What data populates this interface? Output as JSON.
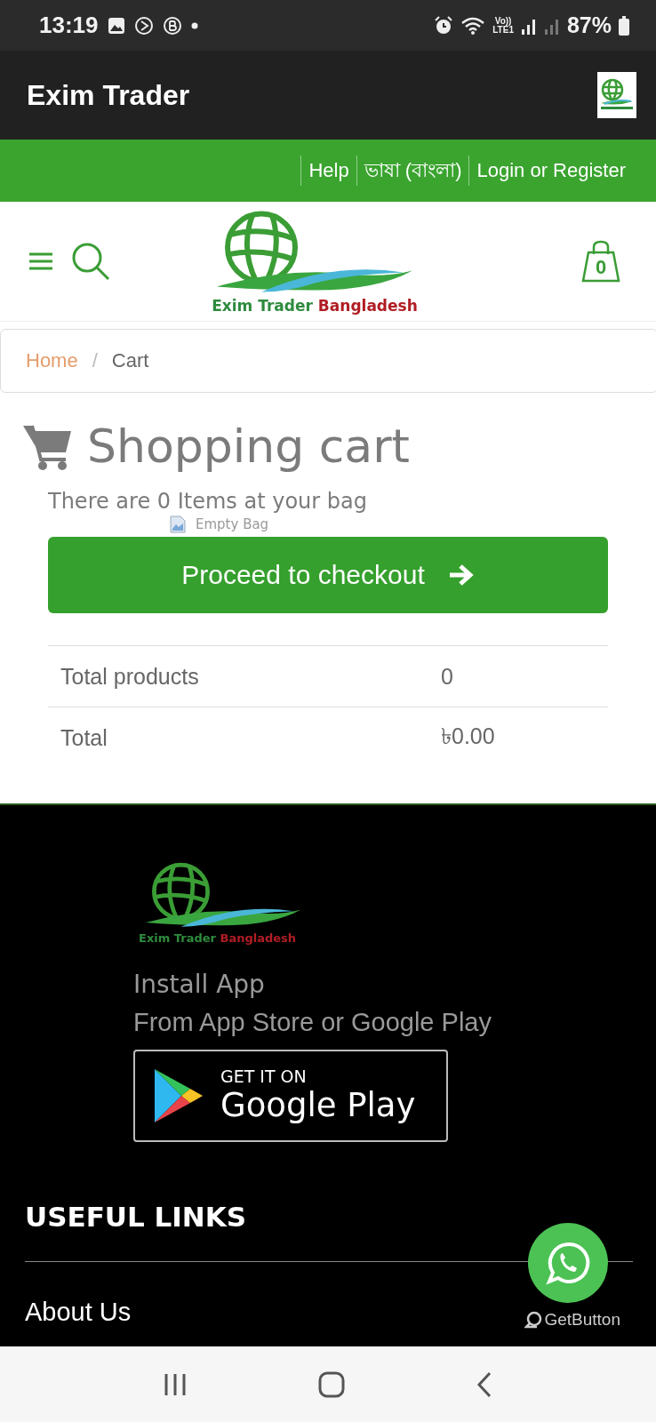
{
  "status_bar": {
    "time": "13:19",
    "network": {
      "top": "Vo))",
      "bottom": "LTE1"
    },
    "battery": "87%"
  },
  "app_bar": {
    "title": "Exim Trader"
  },
  "top_links": [
    "Help",
    "ভাষা (বাংলা)",
    "Login or Register"
  ],
  "header": {
    "logo": {
      "text_1": "Exim Trader",
      "text_2": "Bangladesh"
    },
    "cart_count": "0"
  },
  "breadcrumb": {
    "items": [
      {
        "label": "Home",
        "kind": "link"
      },
      {
        "label": "Cart",
        "kind": "current"
      }
    ],
    "separator": "/"
  },
  "cart": {
    "title": "Shopping cart",
    "message": "There are 0 Items at your bag",
    "image_alt": "Empty Bag",
    "checkout_button": "Proceed to checkout",
    "summary": [
      {
        "label": "Total products",
        "value": "0"
      },
      {
        "label": "Total",
        "value": "৳0.00"
      }
    ]
  },
  "footer": {
    "logo": {
      "text_1": "Exim Trader",
      "text_2": "Bangladesh"
    },
    "install_title": "Install App",
    "install_subtitle": "From App Store or Google Play",
    "badge": {
      "small": "GET IT ON",
      "large": "Google Play"
    },
    "links_title": "USEFUL LINKS",
    "links": [
      "About Us"
    ]
  },
  "chat_widget": {
    "label": "GetButton"
  }
}
